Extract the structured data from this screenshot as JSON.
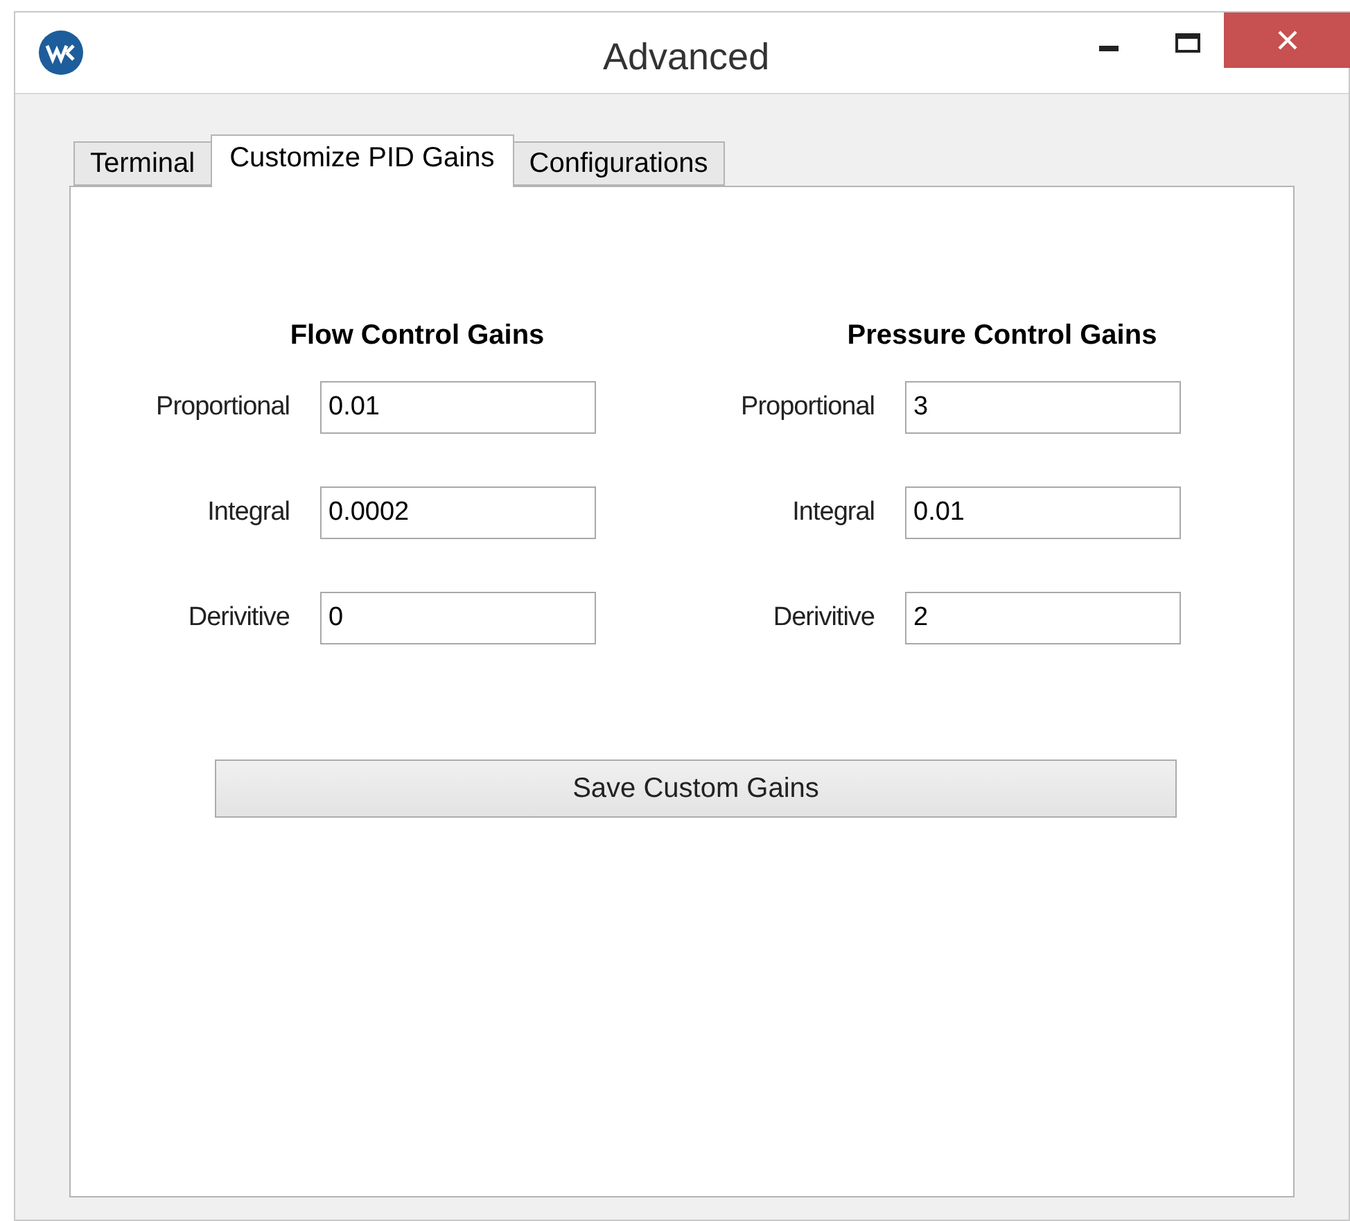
{
  "window": {
    "title": "Advanced"
  },
  "tabs": [
    {
      "label": "Terminal",
      "selected": false
    },
    {
      "label": "Customize PID Gains",
      "selected": true
    },
    {
      "label": "Configurations",
      "selected": false
    }
  ],
  "groups": [
    {
      "title": "Flow Control Gains",
      "fields": [
        {
          "label": "Proportional",
          "value": "0.01"
        },
        {
          "label": "Integral",
          "value": "0.0002"
        },
        {
          "label": "Derivitive",
          "value": "0"
        }
      ]
    },
    {
      "title": "Pressure Control Gains",
      "fields": [
        {
          "label": "Proportional",
          "value": "3"
        },
        {
          "label": "Integral",
          "value": "0.01"
        },
        {
          "label": "Derivitive",
          "value": "2"
        }
      ]
    }
  ],
  "save_button": "Save Custom Gains"
}
